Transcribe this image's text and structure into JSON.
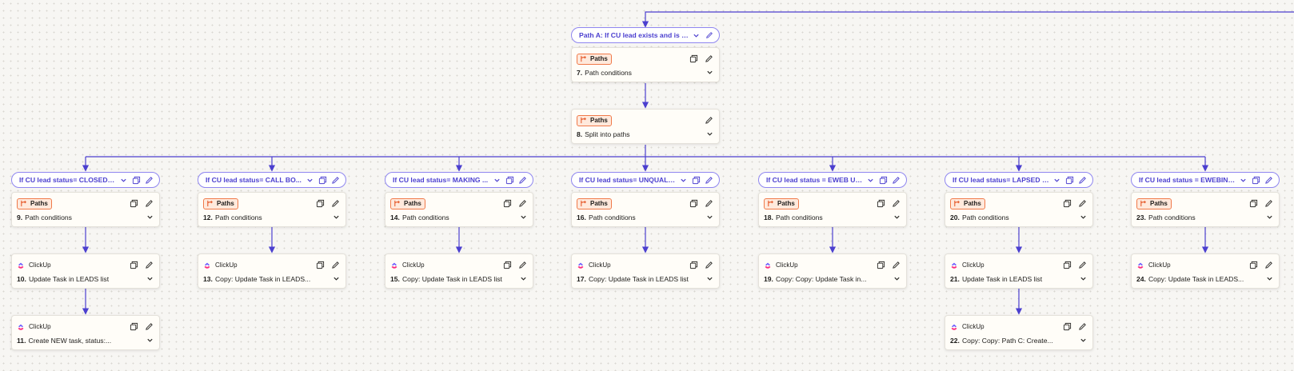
{
  "colors": {
    "wire": "#4b3fcf",
    "pill_border": "#8f86f0",
    "paths_accent": "#f07a4a",
    "clickup_pink": "#fd2d7d",
    "clickup_blue": "#6b5cff"
  },
  "icons": {
    "copy": "copy-icon",
    "edit": "pencil-icon",
    "expand": "chevron-down-icon",
    "paths_app": "paths-branch-icon",
    "clickup_app": "clickup-logo-icon"
  },
  "top": {
    "pill": {
      "label": "Path A: If CU lead exists and is i..."
    },
    "step7": {
      "app": "Paths",
      "step": "7.",
      "title": "Path conditions"
    },
    "step8": {
      "app": "Paths",
      "step": "8.",
      "title": "Split into paths"
    }
  },
  "branches": [
    {
      "pill": "If CU lead status= CLOSED [...",
      "steps": [
        {
          "app": "Paths",
          "step": "9.",
          "title": "Path conditions"
        },
        {
          "app": "ClickUp",
          "step": "10.",
          "title": "Update Task in LEADS list"
        },
        {
          "app": "ClickUp",
          "step": "11.",
          "title": "Create NEW task, status:..."
        }
      ]
    },
    {
      "pill": "If CU lead status= CALL BO...",
      "steps": [
        {
          "app": "Paths",
          "step": "12.",
          "title": "Path conditions"
        },
        {
          "app": "ClickUp",
          "step": "13.",
          "title": "Copy: Update Task in LEADS..."
        }
      ]
    },
    {
      "pill": "If CU lead status= MAKING ...",
      "steps": [
        {
          "app": "Paths",
          "step": "14.",
          "title": "Path conditions"
        },
        {
          "app": "ClickUp",
          "step": "15.",
          "title": "Copy: Update Task in LEADS list"
        }
      ]
    },
    {
      "pill": "If CU lead status= UNQUALI...",
      "steps": [
        {
          "app": "Paths",
          "step": "16.",
          "title": "Path conditions"
        },
        {
          "app": "ClickUp",
          "step": "17.",
          "title": "Copy: Update Task in LEADS list"
        }
      ]
    },
    {
      "pill": "If CU lead status = EWEB UN...",
      "steps": [
        {
          "app": "Paths",
          "step": "18.",
          "title": "Path conditions"
        },
        {
          "app": "ClickUp",
          "step": "19.",
          "title": "Copy: Copy: Update Task in..."
        }
      ]
    },
    {
      "pill": "If CU lead status= LAPSED C...",
      "steps": [
        {
          "app": "Paths",
          "step": "20.",
          "title": "Path conditions"
        },
        {
          "app": "ClickUp",
          "step": "21.",
          "title": "Update Task in LEADS list"
        },
        {
          "app": "ClickUp",
          "step": "22.",
          "title": "Copy: Copy: Path C: Create..."
        }
      ]
    },
    {
      "pill": "If CU lead status = EWEBINAR",
      "steps": [
        {
          "app": "Paths",
          "step": "23.",
          "title": "Path conditions"
        },
        {
          "app": "ClickUp",
          "step": "24.",
          "title": "Copy: Update Task in LEADS..."
        }
      ]
    }
  ]
}
